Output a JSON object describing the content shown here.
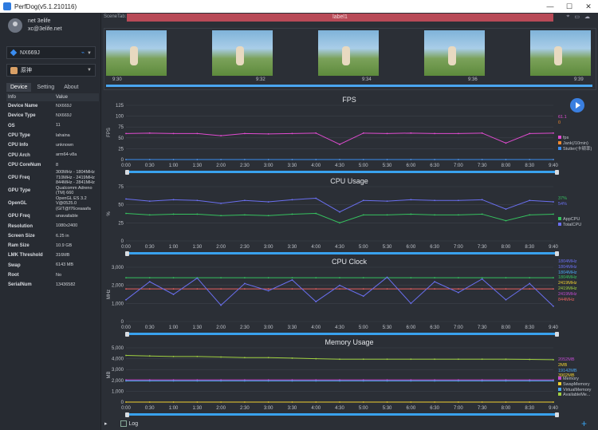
{
  "window": {
    "title": "PerfDog(v5.1.210116)",
    "controls": [
      "—",
      "☐",
      "✕"
    ]
  },
  "user": {
    "name": "net 3elife",
    "email": "xc@3elife.net"
  },
  "device": {
    "name": "NX669J"
  },
  "app": {
    "name": "原神"
  },
  "tabs": [
    "Device",
    "Setting",
    "About"
  ],
  "info": {
    "headers": [
      "Info",
      "Value"
    ],
    "rows": [
      [
        "Device Name",
        "NX669J"
      ],
      [
        "Device Type",
        "NX669J"
      ],
      [
        "OS",
        "11"
      ],
      [
        "CPU Type",
        "lahaina"
      ],
      [
        "CPU Info",
        "unknown"
      ],
      [
        "CPU Arch",
        "arm64-v8a"
      ],
      [
        "CPU CoreNum",
        "8"
      ],
      [
        "CPU Freq",
        "300MHz - 1804MHz\n710MHz - 2419MHz\n844MHz - 2841MHz"
      ],
      [
        "GPU Type",
        "Qualcomm Adreno\n(TM) 660"
      ],
      [
        "OpenGL",
        "OpenGL ES 3.2\nV@0525.0\n(GIT@f76ceaaafa"
      ],
      [
        "GPU Freq",
        "unavailable"
      ],
      [
        "Resolution",
        "1080x2400"
      ],
      [
        "Screen Size",
        "6.25 in"
      ],
      [
        "Ram Size",
        "10.9 GB"
      ],
      [
        "LMK Threshold",
        "316MB"
      ],
      [
        "Swap",
        "6143 MB"
      ],
      [
        "Root",
        "No"
      ],
      [
        "SerialNum",
        "13436582"
      ]
    ]
  },
  "scene": {
    "tab_label": "SceneTab:",
    "label": "label1",
    "thumb_times": [
      "9:30",
      "9:32",
      "9:34",
      "9:36",
      "9:39"
    ]
  },
  "x_ticks": [
    "0:00",
    "0:30",
    "1:00",
    "1:30",
    "2:00",
    "2:30",
    "3:00",
    "3:30",
    "4:00",
    "4:30",
    "5:00",
    "5:30",
    "6:00",
    "6:30",
    "7:00",
    "7:30",
    "8:00",
    "8:30",
    "9:40"
  ],
  "colors": {
    "accent": "#39a2ee",
    "fps": "#e04bd0",
    "jank": "#f08a30",
    "stutter": "#3a8df0",
    "app_cpu": "#36c15f",
    "total_cpu": "#6a6ff0",
    "clock": "#e86060",
    "memory": "#c04bd0",
    "swap": "#f0d030",
    "virtual": "#4aa6f0",
    "available": "#a0d040"
  },
  "chart_data": [
    {
      "type": "line",
      "title": "FPS",
      "ylabel": "FPS",
      "ylim": [
        0,
        125
      ],
      "yticks": [
        "125",
        "100",
        "75",
        "50",
        "25",
        "0"
      ],
      "x": [
        "0:00",
        "0:30",
        "1:00",
        "1:30",
        "2:00",
        "2:30",
        "3:00",
        "3:30",
        "4:00",
        "4:30",
        "5:00",
        "5:30",
        "6:00",
        "6:30",
        "7:00",
        "7:30",
        "8:00",
        "8:30",
        "9:40"
      ],
      "series": [
        {
          "name": "fps",
          "values": [
            60,
            61,
            60,
            60,
            55,
            60,
            59,
            60,
            61,
            35,
            61,
            60,
            61,
            60,
            60,
            61,
            38,
            60,
            61
          ]
        },
        {
          "name": "Jank(/10min)",
          "values": [
            0,
            0,
            0,
            0,
            0,
            0,
            0,
            0,
            0,
            0,
            0,
            0,
            0,
            0,
            0,
            0,
            0,
            0,
            0
          ]
        },
        {
          "name": "Stutter(卡顿率)",
          "values": [
            0,
            0,
            0,
            0,
            0,
            0,
            0,
            0,
            0,
            0,
            0,
            0,
            0,
            0,
            0,
            0,
            0,
            0,
            0
          ]
        }
      ],
      "current": [
        "61.1",
        "0"
      ]
    },
    {
      "type": "line",
      "title": "CPU Usage",
      "ylabel": "%",
      "ylim": [
        0,
        75
      ],
      "yticks": [
        "75",
        "50",
        "25",
        "0"
      ],
      "x": [
        "0:00",
        "0:30",
        "1:00",
        "1:30",
        "2:00",
        "2:30",
        "3:00",
        "3:30",
        "4:00",
        "4:30",
        "5:00",
        "5:30",
        "6:00",
        "6:30",
        "7:00",
        "7:30",
        "8:00",
        "8:30",
        "9:40"
      ],
      "series": [
        {
          "name": "AppCPU",
          "values": [
            38,
            36,
            37,
            37,
            35,
            36,
            35,
            37,
            38,
            25,
            36,
            36,
            37,
            36,
            36,
            37,
            28,
            36,
            37
          ]
        },
        {
          "name": "TotalCPU",
          "values": [
            58,
            55,
            57,
            56,
            52,
            56,
            54,
            57,
            59,
            40,
            56,
            55,
            57,
            56,
            56,
            57,
            44,
            56,
            54
          ]
        }
      ],
      "current": [
        "37%",
        "54%"
      ]
    },
    {
      "type": "line",
      "title": "CPU Clock",
      "ylabel": "MHz",
      "ylim": [
        0,
        3000
      ],
      "yticks": [
        "3,000",
        "2,000",
        "1,000",
        "0"
      ],
      "x": [
        "0:00",
        "0:30",
        "1:00",
        "1:30",
        "2:00",
        "2:30",
        "3:00",
        "3:30",
        "4:00",
        "4:30",
        "5:00",
        "5:30",
        "6:00",
        "6:30",
        "7:00",
        "7:30",
        "8:00",
        "8:30",
        "9:40"
      ],
      "series": [
        {
          "name": "CPU0-3",
          "values": [
            1804,
            1804,
            1804,
            1804,
            1804,
            1804,
            1804,
            1804,
            1804,
            1804,
            1804,
            1804,
            1804,
            1804,
            1804,
            1804,
            1804,
            1804,
            1804
          ]
        },
        {
          "name": "CPU4-6",
          "values": [
            2419,
            2419,
            2419,
            2419,
            2419,
            2419,
            2419,
            2419,
            2419,
            2419,
            2419,
            2419,
            2419,
            2419,
            2419,
            2419,
            2419,
            2419,
            2419
          ]
        },
        {
          "name": "CPU7",
          "values": [
            1200,
            2200,
            1500,
            2400,
            900,
            2100,
            1700,
            2300,
            1100,
            2000,
            1400,
            2450,
            1000,
            2200,
            1600,
            2350,
            1200,
            2100,
            844
          ]
        }
      ],
      "current": [
        "1804MHz",
        "1804MHz",
        "1804MHz",
        "1804MHz",
        "2419MHz",
        "2419MHz",
        "2419MHz",
        "844MHz"
      ]
    },
    {
      "type": "line",
      "title": "Memory Usage",
      "ylabel": "MB",
      "ylim": [
        0,
        5000
      ],
      "yticks": [
        "5,000",
        "4,000",
        "3,000",
        "2,000",
        "1,000",
        "0"
      ],
      "x": [
        "0:00",
        "0:30",
        "1:00",
        "1:30",
        "2:00",
        "2:30",
        "3:00",
        "3:30",
        "4:00",
        "4:30",
        "5:00",
        "5:30",
        "6:00",
        "6:30",
        "7:00",
        "7:30",
        "8:00",
        "8:30",
        "9:40"
      ],
      "series": [
        {
          "name": "Memory",
          "values": [
            2050,
            2050,
            2050,
            2050,
            2050,
            2052,
            2052,
            2052,
            2052,
            2052,
            2052,
            2052,
            2052,
            2052,
            2052,
            2052,
            2052,
            2052,
            2052
          ]
        },
        {
          "name": "SwapMemory",
          "values": [
            2,
            2,
            2,
            2,
            2,
            2,
            2,
            2,
            2,
            2,
            2,
            2,
            2,
            2,
            2,
            2,
            2,
            2,
            2
          ]
        },
        {
          "name": "VirtualMemory",
          "values": [
            1950,
            1950,
            1950,
            1950,
            1950,
            1950,
            1950,
            1950,
            1950,
            1950,
            1950,
            1950,
            1950,
            1950,
            1950,
            1950,
            1950,
            1950,
            1950
          ]
        },
        {
          "name": "AvailableMe...",
          "values": [
            4300,
            4250,
            4200,
            4200,
            4150,
            4100,
            4100,
            4050,
            4000,
            3950,
            3950,
            3950,
            3950,
            3950,
            3950,
            3950,
            3950,
            3930,
            3902
          ]
        }
      ],
      "current": [
        "2052MB",
        "2MB",
        "19142MB",
        "3902MB"
      ]
    }
  ],
  "bottom": {
    "log_label": "Log"
  }
}
